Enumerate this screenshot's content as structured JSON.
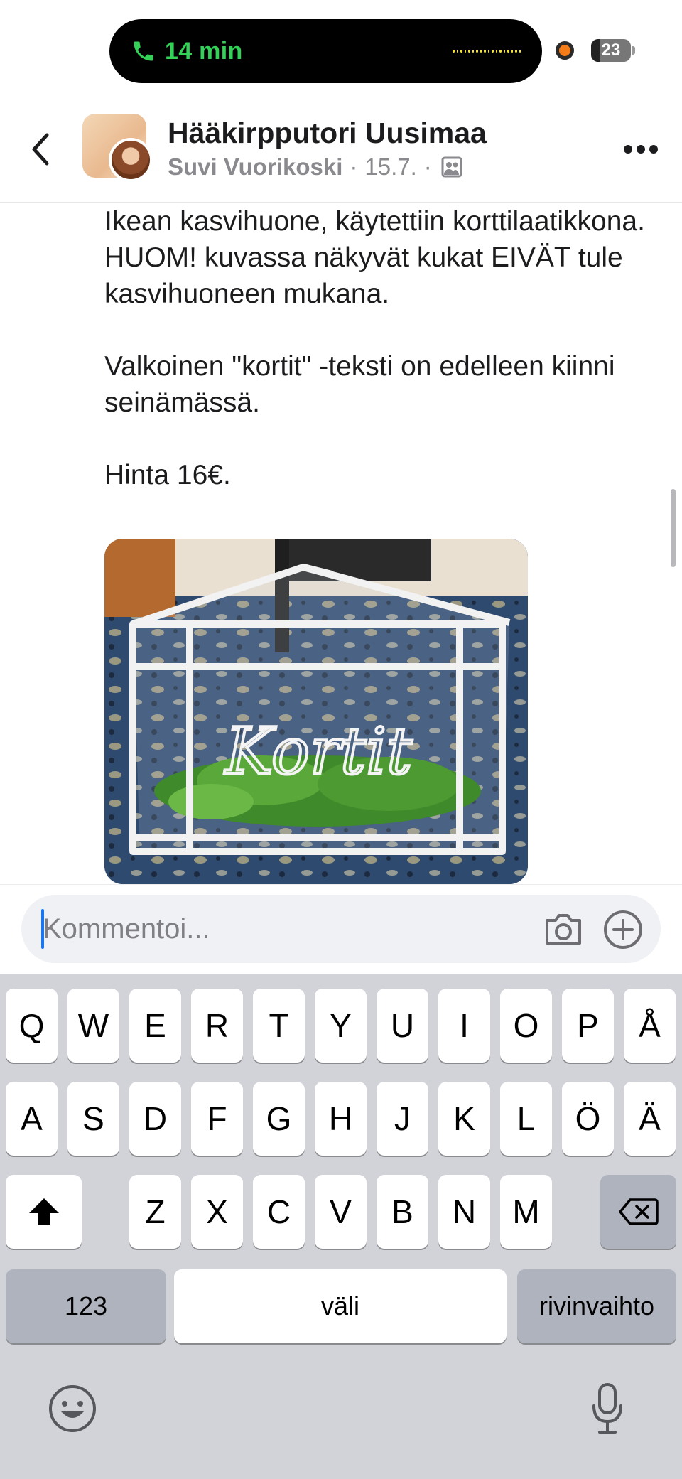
{
  "status_bar": {
    "call_time": "14 min",
    "battery_level": "23"
  },
  "header": {
    "group_name": "Hääkirpputori Uusimaa",
    "author": "Suvi Vuorikoski",
    "separator": "·",
    "date": "15.7.",
    "audience_icon": "group-members-icon",
    "back_icon": "chevron-left-icon",
    "more_icon": "more-dots-icon"
  },
  "post": {
    "paragraphs": [
      "Ikean kasvihuone, käytettiin korttilaatikkona. HUOM! kuvassa näkyvät kukat EIVÄT tule kasvihuoneen mukana.",
      "Valkoinen \"kortit\" -teksti on edelleen kiinni seinämässä.",
      "Hinta 16€."
    ],
    "photo_caption_text": "Kortit"
  },
  "comment_bar": {
    "placeholder": "Kommentoi...",
    "camera_icon": "camera-icon",
    "add_icon": "plus-circle-icon"
  },
  "keyboard": {
    "row1": [
      "Q",
      "W",
      "E",
      "R",
      "T",
      "Y",
      "U",
      "I",
      "O",
      "P",
      "Å"
    ],
    "row2": [
      "A",
      "S",
      "D",
      "F",
      "G",
      "H",
      "J",
      "K",
      "L",
      "Ö",
      "Ä"
    ],
    "row3": [
      "Z",
      "X",
      "C",
      "V",
      "B",
      "N",
      "M"
    ],
    "numbers_label": "123",
    "space_label": "väli",
    "return_label": "rivinvaihto",
    "shift_icon": "shift-icon",
    "backspace_icon": "backspace-icon",
    "emoji_icon": "emoji-icon",
    "mic_icon": "microphone-icon"
  },
  "colors": {
    "call_green": "#34d158",
    "accent_blue": "#1877f2",
    "keyboard_bg": "#d1d3d9"
  }
}
